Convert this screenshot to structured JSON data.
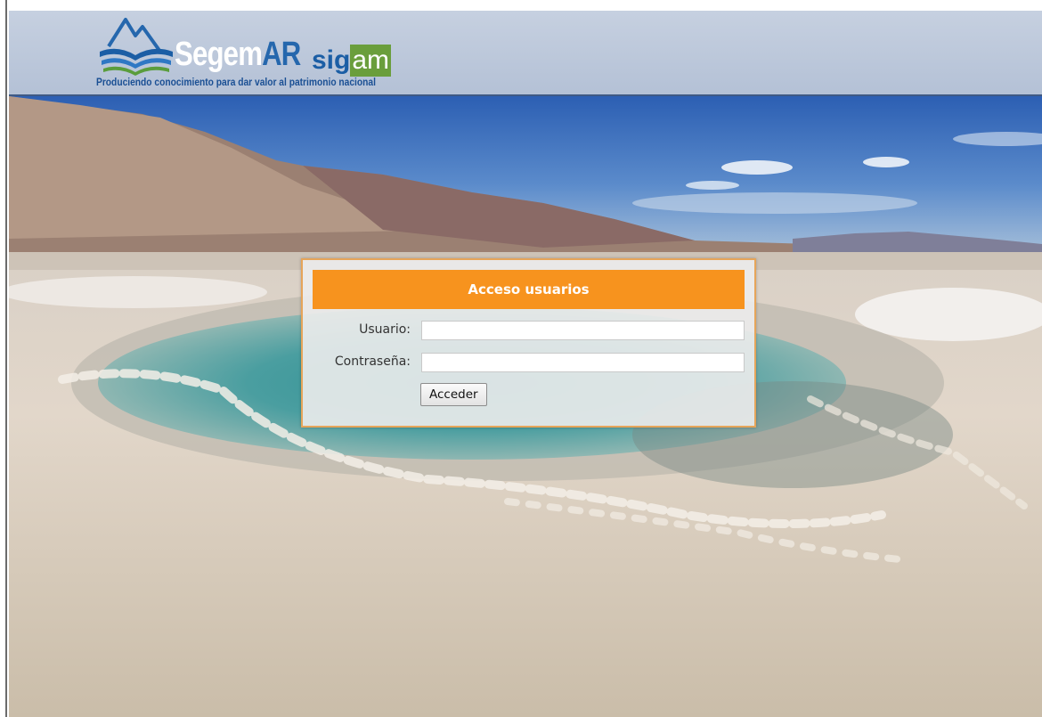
{
  "header": {
    "brand_segem": "Segem",
    "brand_ar": "AR",
    "brand_sig": "sig",
    "brand_am": "am",
    "tagline": "Produciendo conocimiento para dar valor al patrimonio nacional",
    "logo_icon": "mountain-book-icon"
  },
  "login": {
    "title": "Acceso usuarios",
    "username_label": "Usuario:",
    "username_value": "",
    "password_label": "Contraseña:",
    "password_value": "",
    "submit_label": "Acceder"
  },
  "colors": {
    "accent": "#f7931e",
    "brand_blue": "#2567ad",
    "brand_green": "#6a9e3c",
    "header_bg": "#c6d0e0"
  }
}
